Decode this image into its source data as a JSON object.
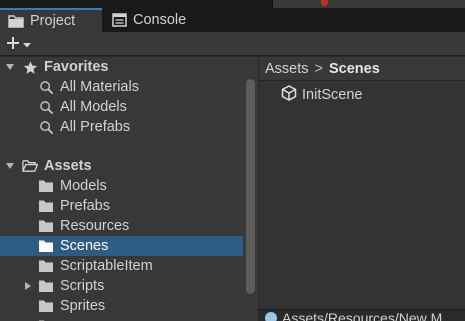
{
  "tabs": [
    {
      "label": "Project",
      "icon": "folder-icon",
      "active": true
    },
    {
      "label": "Console",
      "icon": "console-icon",
      "active": false
    }
  ],
  "toolbar": {
    "create_icon": "plus-icon"
  },
  "tree": {
    "favorites": {
      "label": "Favorites",
      "items": [
        "All Materials",
        "All Models",
        "All Prefabs"
      ]
    },
    "assets": {
      "label": "Assets",
      "items": [
        "Models",
        "Prefabs",
        "Resources",
        "Scenes",
        "ScriptableItem",
        "Scripts",
        "Sprites"
      ],
      "selected": "Scenes"
    }
  },
  "breadcrumb": {
    "root": "Assets",
    "separator": ">",
    "current": "Scenes"
  },
  "asset_list": [
    {
      "name": "InitScene",
      "icon": "unity-scene-icon"
    }
  ],
  "status": {
    "path": "Assets/Resources/New M"
  },
  "colors": {
    "accent": "#3a79bb",
    "selection": "#2c5d87",
    "panel": "#383838"
  }
}
